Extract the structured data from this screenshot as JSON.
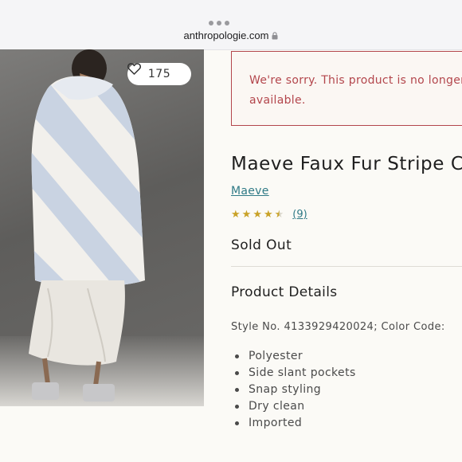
{
  "browser": {
    "url": "anthropologie.com",
    "icons": {
      "menu": "more-dots-icon",
      "lock": "lock-icon"
    }
  },
  "gallery": {
    "likes_count": "175",
    "icons": {
      "like": "heart-outline-icon",
      "expand": "expand-arrows-icon"
    }
  },
  "notice": {
    "message": "We're sorry. This product is no longer available.",
    "color": "#b3464c"
  },
  "product": {
    "title": "Maeve Faux Fur Stripe C",
    "brand": "Maeve",
    "rating": 4.5,
    "reviews": "(9)",
    "availability": "Sold Out",
    "star_color": "#c9a227",
    "link_color": "#2f7a86"
  },
  "details": {
    "heading": "Product Details",
    "style_line": "Style No. 4133929420024; Color Code:",
    "features": [
      "Polyester",
      "Side slant pockets",
      "Snap styling",
      "Dry clean",
      "Imported"
    ]
  }
}
